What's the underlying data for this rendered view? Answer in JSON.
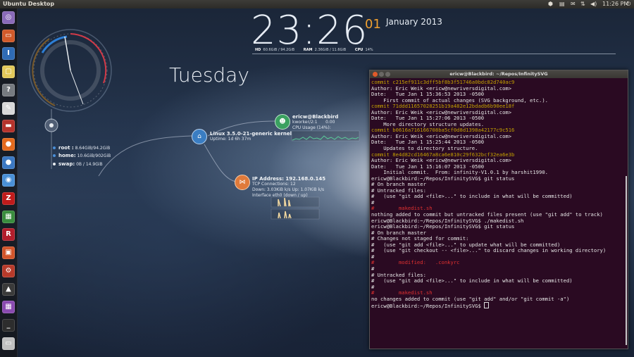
{
  "topbar": {
    "title": "Ubuntu Desktop",
    "time": "11:26 PM"
  },
  "launcher": {
    "items": [
      {
        "name": "dash-icon",
        "color": "#8a6ab8",
        "glyph": "◎"
      },
      {
        "name": "files-icon",
        "color": "#d15a2a",
        "glyph": "▭"
      },
      {
        "name": "editor-icon",
        "color": "#2f6bb5",
        "glyph": "I"
      },
      {
        "name": "notes-icon",
        "color": "#e2c85a",
        "glyph": "▢"
      },
      {
        "name": "help-icon",
        "color": "#777b80",
        "glyph": "?"
      },
      {
        "name": "text-editor-icon",
        "color": "#d8d8d8",
        "glyph": "✎"
      },
      {
        "name": "presentation-icon",
        "color": "#b5332c",
        "glyph": "▬"
      },
      {
        "name": "firefox-icon",
        "color": "#e46a1d",
        "glyph": "●"
      },
      {
        "name": "thunderbird-icon",
        "color": "#3b78c2",
        "glyph": "●"
      },
      {
        "name": "chrome-icon",
        "color": "#4a90d6",
        "glyph": "◉"
      },
      {
        "name": "filezilla-icon",
        "color": "#c01b1b",
        "glyph": "Z"
      },
      {
        "name": "spreadsheet-icon",
        "color": "#3a8d3e",
        "glyph": "▦"
      },
      {
        "name": "reader-icon",
        "color": "#b21e2c",
        "glyph": "R"
      },
      {
        "name": "software-center-icon",
        "color": "#d2552b",
        "glyph": "▣"
      },
      {
        "name": "settings-icon",
        "color": "#b73a2a",
        "glyph": "⚙"
      },
      {
        "name": "inkscape-icon",
        "color": "#3a3a3a",
        "glyph": "▲"
      },
      {
        "name": "image-viewer-icon",
        "color": "#8a4ab0",
        "glyph": "▦"
      },
      {
        "name": "terminal-icon",
        "color": "#2d2d2d",
        "glyph": "_"
      },
      {
        "name": "printer-icon",
        "color": "#c0c0c0",
        "glyph": "▭"
      }
    ]
  },
  "clock": {
    "time": "23:26",
    "day": "01",
    "month_year": "January 2013",
    "hd_label": "HD",
    "hd_value": "60.6GiB / 94.2GiB",
    "ram_label": "RAM",
    "ram_value": "2.36GiB / 11.6GiB",
    "cpu_label": "CPU",
    "cpu_value": "14%"
  },
  "weekday": "Tuesday",
  "disk": {
    "root_label": "root :",
    "root_value": "8.64GiB/94.2GiB",
    "home_label": "home:",
    "home_value": "10.6GiB/902GiB",
    "swap_label": "swap:",
    "swap_value": "0B  / 14.9GiB"
  },
  "kernel": {
    "title": "Linux 3.5.0-21-generic kernel",
    "uptime": "Uptime: 1d 6h 37m"
  },
  "user": {
    "title": "ericw@Blackbird",
    "proc": "kworker/2:1",
    "proc_val": "0.00",
    "cpu": "CPU Usage (14%):"
  },
  "network": {
    "title": "IP Address: 192.168.0.145",
    "tcp": "TCP Connections: 12",
    "rates": "Down: 3.03KiB k/s   Up: 1.07KiB k/s",
    "iface": "Interface eth0 (down / up)"
  },
  "terminal": {
    "title": "ericw@Blackbird: ~/Repos/InfinitySVG",
    "lines": [
      {
        "t": "commit c215ef911c3dff5bf8b3f51746a0bdc82d740ac9",
        "c": "c-y"
      },
      {
        "t": "Author: Eric Weik <ericw@newriversdigital.com>",
        "c": ""
      },
      {
        "t": "Date:   Tue Jan 1 15:36:53 2013 -0500",
        "c": ""
      },
      {
        "t": "",
        "c": ""
      },
      {
        "t": "    First commit of actual changes (SVG background, etc.).",
        "c": ""
      },
      {
        "t": "",
        "c": ""
      },
      {
        "t": "commit 71ddd11657028251b19a482e12bdadb6b90ee18f",
        "c": "c-y"
      },
      {
        "t": "Author: Eric Weik <ericw@newriversdigital.com>",
        "c": ""
      },
      {
        "t": "Date:   Tue Jan 1 15:27:06 2013 -0500",
        "c": ""
      },
      {
        "t": "",
        "c": ""
      },
      {
        "t": "    More directory structure updates.",
        "c": ""
      },
      {
        "t": "",
        "c": ""
      },
      {
        "t": "commit b0616a716166708ba5cf0d8d1398a42177c9c516",
        "c": "c-y"
      },
      {
        "t": "Author: Eric Weik <ericw@newriversdigital.com>",
        "c": ""
      },
      {
        "t": "Date:   Tue Jan 1 15:25:44 2013 -0500",
        "c": ""
      },
      {
        "t": "",
        "c": ""
      },
      {
        "t": "    Updates to directory structure.",
        "c": ""
      },
      {
        "t": "",
        "c": ""
      },
      {
        "t": "commit 8e4d82cd16467a8ca6e810c29f632bcf32ea6e3b",
        "c": "c-y"
      },
      {
        "t": "Author: Eric Weik <ericw@newriversdigital.com>",
        "c": ""
      },
      {
        "t": "Date:   Tue Jan 1 15:16:07 2013 -0500",
        "c": ""
      },
      {
        "t": "",
        "c": ""
      },
      {
        "t": "    Initial commit.  From: infinity-V1.0.1 by harshit1990.",
        "c": ""
      },
      {
        "t": "ericw@Blackbird:~/Repos/InfinitySVG$ git status",
        "c": ""
      },
      {
        "t": "# On branch master",
        "c": ""
      },
      {
        "t": "# Untracked files:",
        "c": ""
      },
      {
        "t": "#   (use \"git add <file>...\" to include in what will be committed)",
        "c": ""
      },
      {
        "t": "#",
        "c": ""
      },
      {
        "t": "#\tmakedist.sh",
        "c": "c-r"
      },
      {
        "t": "nothing added to commit but untracked files present (use \"git add\" to track)",
        "c": ""
      },
      {
        "t": "ericw@Blackbird:~/Repos/InfinitySVG$ ./makedist.sh",
        "c": ""
      },
      {
        "t": "ericw@Blackbird:~/Repos/InfinitySVG$ git status",
        "c": ""
      },
      {
        "t": "# On branch master",
        "c": ""
      },
      {
        "t": "# Changes not staged for commit:",
        "c": ""
      },
      {
        "t": "#   (use \"git add <file>...\" to update what will be committed)",
        "c": ""
      },
      {
        "t": "#   (use \"git checkout -- <file>...\" to discard changes in working directory)",
        "c": ""
      },
      {
        "t": "#",
        "c": ""
      },
      {
        "t": "#\tmodified:   .conkyrc",
        "c": "c-r"
      },
      {
        "t": "#",
        "c": ""
      },
      {
        "t": "# Untracked files:",
        "c": ""
      },
      {
        "t": "#   (use \"git add <file>...\" to include in what will be committed)",
        "c": ""
      },
      {
        "t": "#",
        "c": ""
      },
      {
        "t": "#\tmakedist.sh",
        "c": "c-r"
      },
      {
        "t": "no changes added to commit (use \"git add\" and/or \"git commit -a\")",
        "c": ""
      },
      {
        "t": "ericw@Blackbird:~/Repos/InfinitySVG$ ",
        "c": "prompt"
      }
    ]
  }
}
